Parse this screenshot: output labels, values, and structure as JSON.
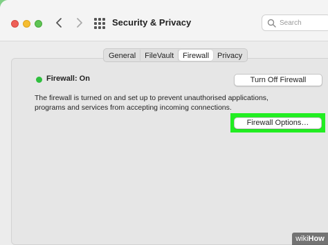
{
  "window": {
    "title": "Security & Privacy",
    "search_placeholder": "Search"
  },
  "tabs": [
    {
      "label": "General",
      "active": false
    },
    {
      "label": "FileVault",
      "active": false
    },
    {
      "label": "Firewall",
      "active": true
    },
    {
      "label": "Privacy",
      "active": false
    }
  ],
  "firewall": {
    "status": "Firewall: On",
    "status_color": "#2fbf3e",
    "toggle_button": "Turn Off Firewall",
    "description": "The firewall is turned on and set up to prevent unauthorised applications, programs and services from accepting incoming connections.",
    "options_button": "Firewall Options…",
    "highlight_color": "#22ee22"
  },
  "watermark": {
    "part1": "wiki",
    "part2": "How"
  }
}
